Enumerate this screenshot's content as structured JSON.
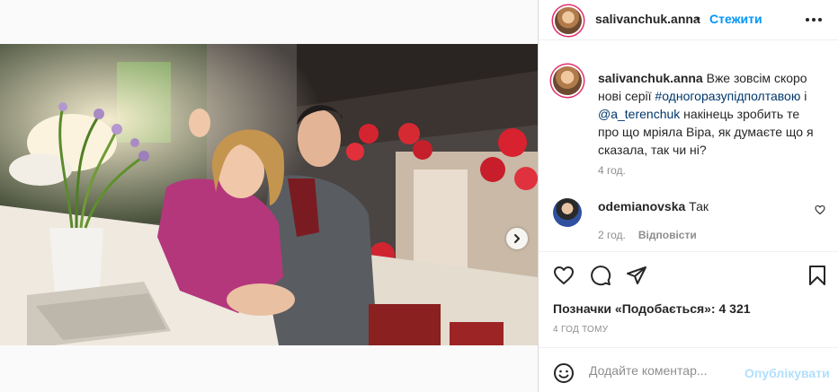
{
  "author": {
    "username": "salivanchuk.anna",
    "separator": "•",
    "follow_label": "Стежити"
  },
  "caption": {
    "username": "salivanchuk.anna",
    "part1": " Вже зовсім скоро нові серії ",
    "hashtag": "#одногоразупідполтавою",
    "part2": " і ",
    "mention": "@a_terenchuk",
    "part3": " накінець зробить те про що мріяла Віра, як думаєте що я сказала, так чи ні?",
    "time": "4 год."
  },
  "comments": [
    {
      "username": "odemianovska",
      "text": " Так",
      "time": "2 год.",
      "reply_label": "Відповісти"
    }
  ],
  "likes_label": "Позначки «Подобається»: 4 321",
  "post_time": "4 ГОД ТОМУ",
  "add_comment": {
    "placeholder": "Додайте коментар...",
    "publish_label": "Опублікувати"
  },
  "carousel": {
    "slide_count": 4,
    "active_index": 0
  },
  "colors": {
    "link_blue": "#0095f6",
    "publish_disabled": "#b2dffc",
    "hashtag": "#00376b"
  },
  "icons": [
    "more-icon",
    "heart-icon",
    "comment-icon",
    "share-icon",
    "bookmark-icon",
    "emoji-icon",
    "tag-user-icon",
    "next-arrow-icon"
  ]
}
